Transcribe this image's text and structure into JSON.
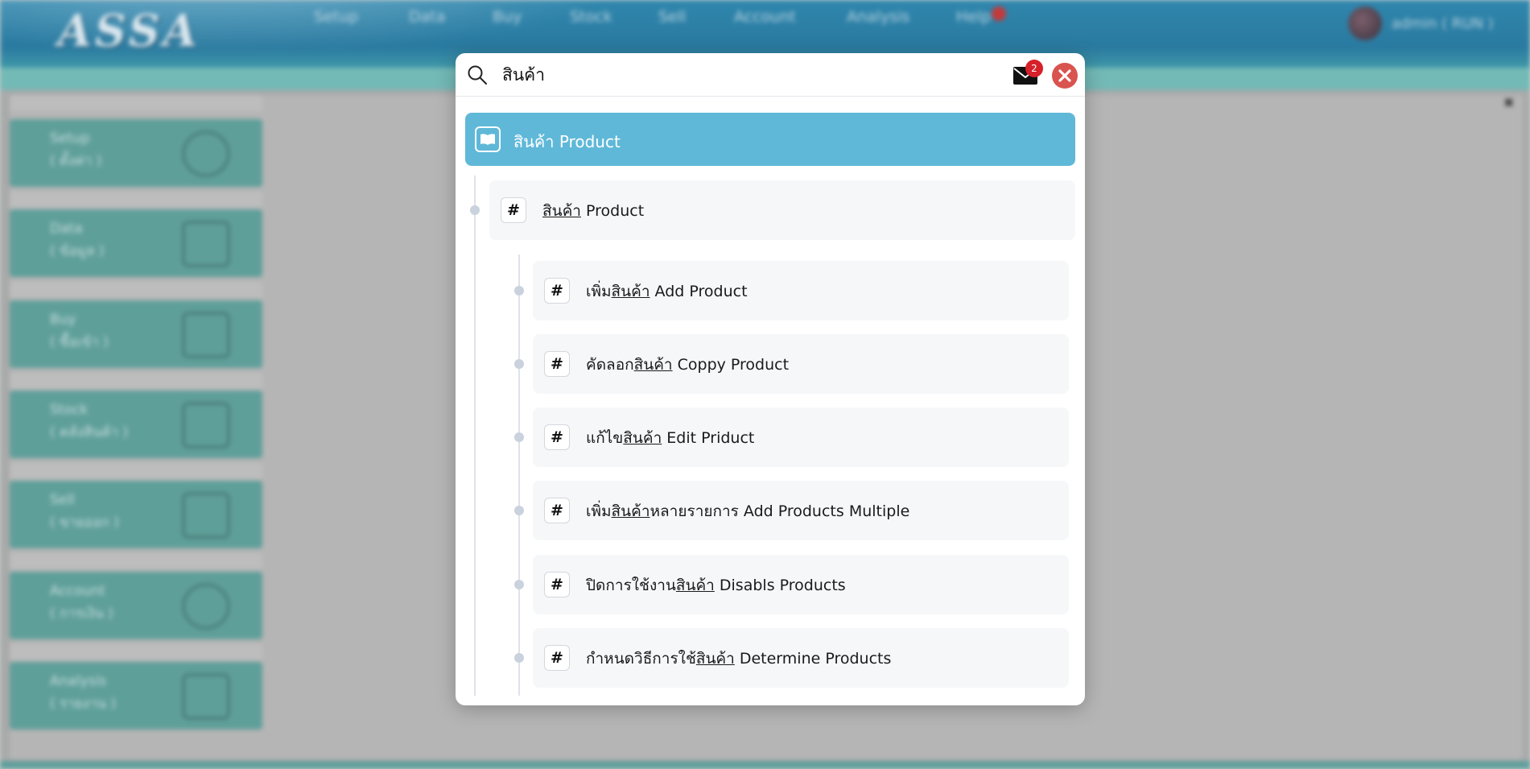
{
  "app": {
    "logo": "ASSA",
    "menu": [
      "Setup",
      "Data",
      "Buy",
      "Stock",
      "Sell",
      "Account",
      "Analysis",
      "Help"
    ],
    "user": "admin ( RUN )",
    "sidebar": [
      {
        "title": "Setup",
        "subtitle": "( ตั้งค่า )"
      },
      {
        "title": "Data",
        "subtitle": "( ข้อมูล )"
      },
      {
        "title": "Buy",
        "subtitle": "( ซื้อเข้า )"
      },
      {
        "title": "Stock",
        "subtitle": "( คลังสินค้า )"
      },
      {
        "title": "Sell",
        "subtitle": "( ขายออก )"
      },
      {
        "title": "Account",
        "subtitle": "( การเงิน )"
      },
      {
        "title": "Analysis",
        "subtitle": "( รายงาน )"
      }
    ]
  },
  "search": {
    "query": "สินค้า",
    "mail_count": "2",
    "colors": {
      "accent": "#5fb8d8",
      "close": "#d9534f",
      "badge": "#d6202a"
    }
  },
  "results": {
    "top": {
      "label": "สินค้า Product",
      "icon": "book-icon"
    },
    "group": {
      "prefix": "",
      "match": "สินค้า",
      "suffix": " Product"
    },
    "items": [
      {
        "prefix": "เพิ่ม",
        "match": "สินค้า",
        "suffix": " Add Product"
      },
      {
        "prefix": "คัดลอก",
        "match": "สินค้า",
        "suffix": " Coppy Product"
      },
      {
        "prefix": "แก้ไข",
        "match": "สินค้า",
        "suffix": " Edit Priduct"
      },
      {
        "prefix": "เพิ่ม",
        "match": "สินค้า",
        "suffix": "หลายรายการ Add Products Multiple"
      },
      {
        "prefix": "ปิดการใช้งาน",
        "match": "สินค้า",
        "suffix": " Disabls Products"
      },
      {
        "prefix": "กำหนดวิธีการใช้",
        "match": "สินค้า",
        "suffix": " Determine Products"
      }
    ],
    "hash_symbol": "#"
  }
}
